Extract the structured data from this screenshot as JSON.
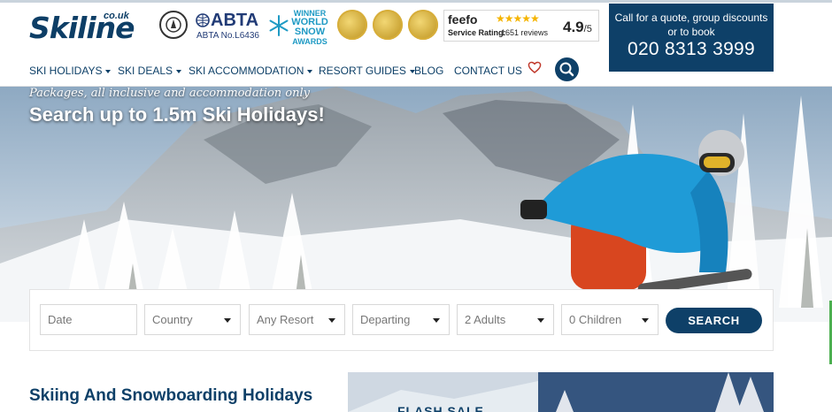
{
  "header": {
    "logo": {
      "brand": "Skiline",
      "tld": "co.uk"
    },
    "abta": {
      "logo": "ABTA",
      "number": "ABTA No.L6436"
    },
    "world_snow_awards": {
      "winner": "WINNER",
      "line1": "WORLD",
      "line2": "SNOW",
      "line3": "AWARDS"
    },
    "feefo": {
      "name": "feefo",
      "stars": "★★★★★",
      "label": "Service Rating:",
      "reviews": "1651 reviews",
      "score": "4.9",
      "out_of": "/5"
    },
    "call_box": {
      "text": "Call for a quote, group discounts or to book",
      "phone": "020 8313 3999"
    }
  },
  "nav": {
    "items": [
      {
        "label": "SKI HOLIDAYS",
        "has_dropdown": true
      },
      {
        "label": "SKI DEALS",
        "has_dropdown": true
      },
      {
        "label": "SKI ACCOMMODATION",
        "has_dropdown": true
      },
      {
        "label": "RESORT GUIDES",
        "has_dropdown": true
      },
      {
        "label": "BLOG",
        "has_dropdown": false
      },
      {
        "label": "CONTACT US",
        "has_dropdown": false
      }
    ],
    "icons": [
      "heart-icon",
      "search-icon"
    ]
  },
  "hero": {
    "tagline": "Packages, all inclusive and accommodation only",
    "title": "Search up to 1.5m Ski Holidays!"
  },
  "search_form": {
    "date": {
      "placeholder": "Date"
    },
    "country": {
      "value": "Country"
    },
    "resort": {
      "value": "Any Resort"
    },
    "departing": {
      "value": "Departing"
    },
    "adults": {
      "value": "2 Adults"
    },
    "children": {
      "value": "0 Children"
    },
    "search_label": "SEARCH"
  },
  "main": {
    "section_title": "Skiing And Snowboarding Holidays",
    "promo": {
      "label": "FLASH SALE"
    }
  },
  "colors": {
    "brand_navy": "#0e4068",
    "accent_red": "#c0392b",
    "star_gold": "#f5b400"
  }
}
